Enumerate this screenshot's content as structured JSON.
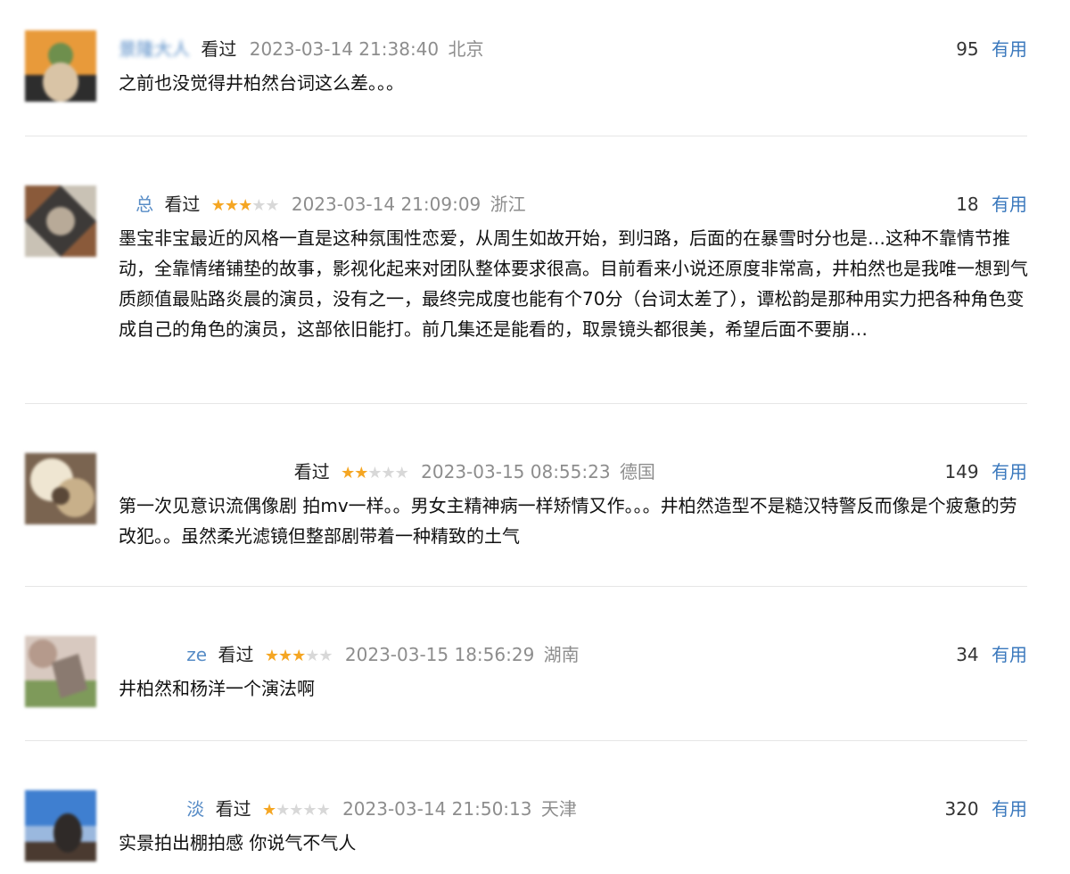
{
  "comments": [
    {
      "username": "景隆大人",
      "status": "看过",
      "rating": null,
      "timestamp": "2023-03-14 21:38:40",
      "location": "北京",
      "votes": "95",
      "useful_label": "有用",
      "content": "之前也没觉得井柏然台词这么差。。。",
      "avatar_colors": [
        "#e89a3a",
        "#6e8f4d",
        "#2d2d2d"
      ]
    },
    {
      "username": "总",
      "status": "看过",
      "rating": 3,
      "timestamp": "2023-03-14 21:09:09",
      "location": "浙江",
      "votes": "18",
      "useful_label": "有用",
      "content": "墨宝非宝最近的风格一直是这种氛围性恋爱，从周生如故开始，到归路，后面的在暴雪时分也是…这种不靠情节推动，全靠情绪铺垫的故事，影视化起来对团队整体要求很高。目前看来小说还原度非常高，井柏然也是我唯一想到气质颜值最贴路炎晨的演员，没有之一，最终完成度也能有个70分（台词太差了），谭松韵是那种用实力把各种角色变成自己的角色的演员，这部依旧能打。前几集还是能看的，取景镜头都很美，希望后面不要崩…",
      "avatar_colors": [
        "#8a5a3a",
        "#c9c2b5",
        "#3d3a38"
      ]
    },
    {
      "username": "",
      "status": "看过",
      "rating": 2,
      "timestamp": "2023-03-15 08:55:23",
      "location": "德国",
      "votes": "149",
      "useful_label": "有用",
      "content": "第一次见意识流偶像剧 拍mv一样。。男女主精神病一样矫情又作。。。井柏然造型不是糙汉特警反而像是个疲惫的劳改犯。。虽然柔光滤镜但整部剧带着一种精致的土气",
      "avatar_colors": [
        "#c8b08a",
        "#efe6d2",
        "#7a6450"
      ]
    },
    {
      "username": "ze",
      "status": "看过",
      "rating": 3,
      "timestamp": "2023-03-15 18:56:29",
      "location": "湖南",
      "votes": "34",
      "useful_label": "有用",
      "content": "井柏然和杨洋一个演法啊",
      "avatar_colors": [
        "#b59a8c",
        "#7e9a5a",
        "#d8c9c0"
      ]
    },
    {
      "username": "淡",
      "status": "看过",
      "rating": 1,
      "timestamp": "2023-03-14 21:50:13",
      "location": "天津",
      "votes": "320",
      "useful_label": "有用",
      "content": "实景拍出棚拍感 你说气不气人",
      "avatar_colors": [
        "#3f7fd0",
        "#9ab8de",
        "#4a3a30"
      ]
    }
  ]
}
